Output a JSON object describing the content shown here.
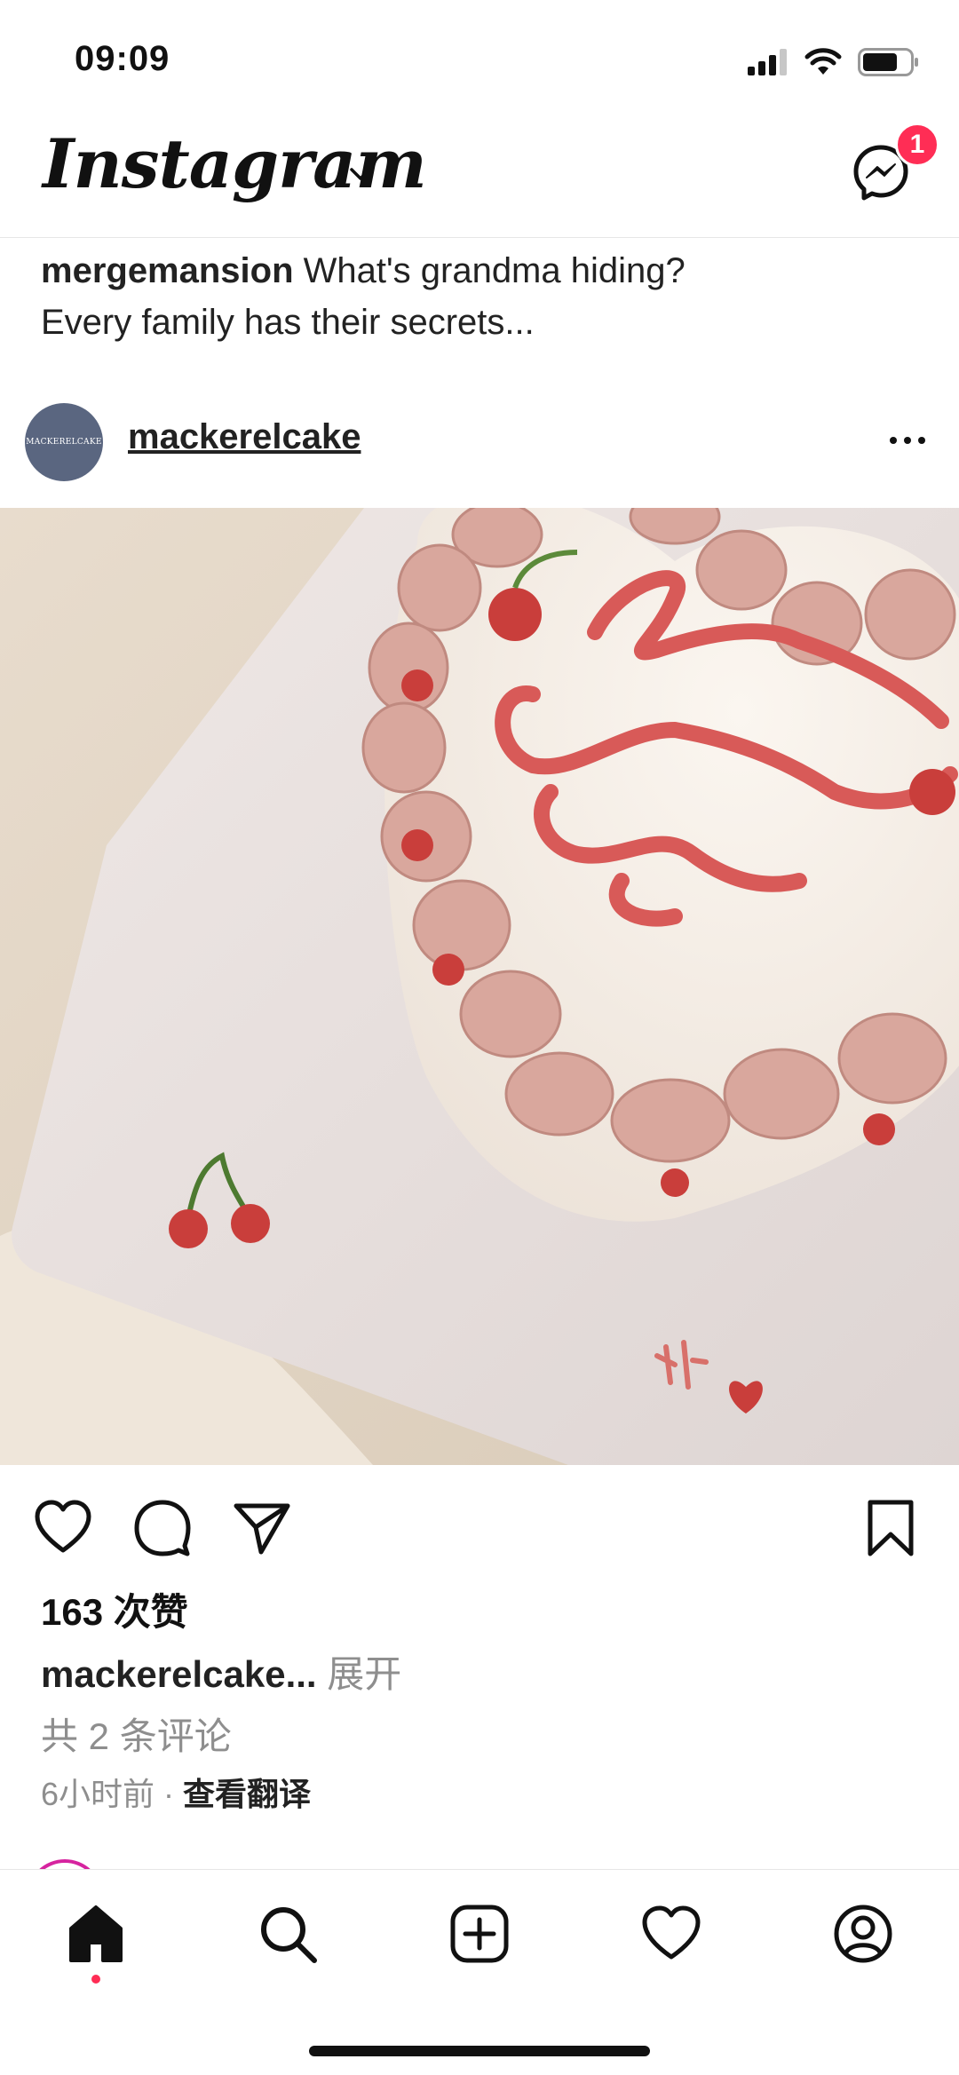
{
  "status_bar": {
    "time": "09:09"
  },
  "header": {
    "logo": "Instagram",
    "messenger_badge": "1"
  },
  "previous_post": {
    "username": "mergemansion",
    "caption_line1": " What's grandma hiding?",
    "caption_line2": "Every family has their secrets..."
  },
  "post": {
    "avatar_text": "MACKERELCAKE",
    "username": "mackerelcake",
    "likes": "163 次赞",
    "caption_user": "mackerelcake...",
    "caption_more": " 展开",
    "comments": "共 2 条评论",
    "time": "6小时前",
    "separator": " · ",
    "translate": "查看翻译",
    "photo_subject": "heart-cake-happy-cherrrii-day"
  },
  "colors": {
    "accent": "#ff2d55",
    "text": "#111111",
    "muted": "#8e8e8e",
    "avatar": "#5a6680"
  },
  "nav": {
    "icons": [
      "home-icon",
      "search-icon",
      "create-icon",
      "activity-icon",
      "profile-icon"
    ]
  }
}
